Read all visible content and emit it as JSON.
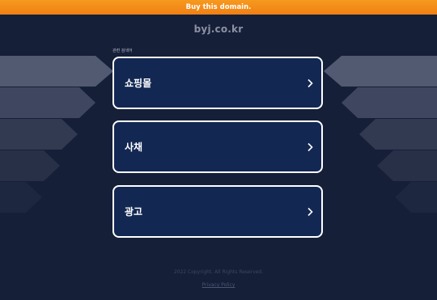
{
  "banner": {
    "label": "Buy this domain."
  },
  "site": {
    "domain": "byj.co.kr"
  },
  "related": {
    "heading": "관련 검색어",
    "items": [
      {
        "label": "쇼핑몰"
      },
      {
        "label": "사채"
      },
      {
        "label": "광고"
      }
    ]
  },
  "footer": {
    "copyright": "2022 Copyright. All Rights Reserved.",
    "privacy": "Privacy Policy"
  },
  "colors": {
    "banner": "#f28a18",
    "background": "#151f38",
    "card": "#132753",
    "card_border": "#ffffff"
  }
}
